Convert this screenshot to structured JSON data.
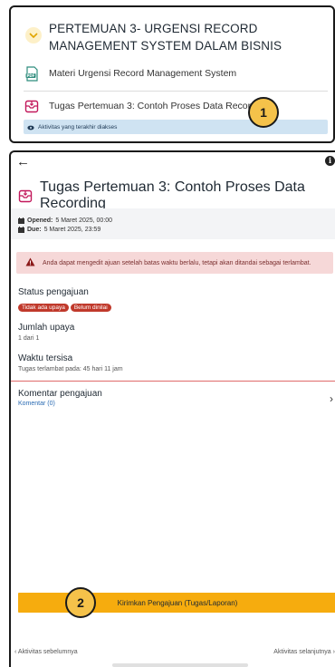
{
  "course": {
    "section_title": "PERTEMUAN 3- URGENSI RECORD MANAGEMENT SYSTEM DALAM BISNIS",
    "activities": [
      {
        "icon": "pdf-icon",
        "label": "Materi Urgensi Record Management System"
      },
      {
        "icon": "assignment-icon",
        "label": "Tugas Pertemuan 3: Contoh Proses Data Recording"
      }
    ],
    "recent_label": "Aktivitas yang terakhir diakses",
    "callout_number": "1"
  },
  "assignment": {
    "title": "Tugas Pertemuan 3: Contoh Proses Data Recording",
    "opened_label": "Opened:",
    "opened_value": "5 Maret 2025, 00:00",
    "due_label": "Due:",
    "due_value": "5 Maret 2025, 23:59",
    "alert": "Anda dapat mengedit ajuan setelah batas waktu berlalu, tetapi akan ditandai sebagai terlambat.",
    "status_title": "Status pengajuan",
    "status_badges": [
      "Tidak ada upaya",
      "Belum dinilai"
    ],
    "attempts_title": "Jumlah upaya",
    "attempts_value": "1 dari 1",
    "time_title": "Waktu tersisa",
    "time_value": "Tugas terlambat pada: 45 hari 11 jam",
    "comments_title": "Komentar pengajuan",
    "comments_link": "Komentar (0)",
    "submit_label": "Kirimkan Pengajuan (Tugas/Laporan)",
    "callout_number": "2",
    "prev_label": "Aktivitas sebelumnya",
    "next_label": "Aktivitas selanjutnya"
  },
  "colors": {
    "accent": "#f6ac0e",
    "badge": "#c0392b",
    "link": "#2a6bb3",
    "alert_bg": "#f6d8d8",
    "recent_bg": "#cfe3f2"
  }
}
